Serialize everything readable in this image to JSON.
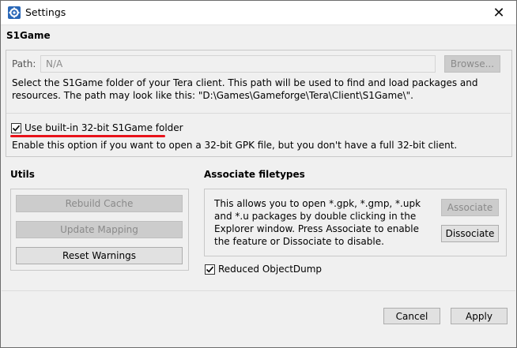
{
  "window": {
    "title": "Settings",
    "app_icon": "tera-gear-icon",
    "close_glyph": "✕"
  },
  "s1game": {
    "heading": "S1Game",
    "path_label": "Path:",
    "path_value": "N/A",
    "browse_label": "Browse...",
    "description": "Select the S1Game folder of your Tera client. This path will be used to find and load packages and resources. The path may look like this: \"D:\\Games\\Gameforge\\Tera\\Client\\S1Game\\\".",
    "builtin_label": "Use built-in 32-bit S1Game folder",
    "builtin_checked": true,
    "builtin_description": "Enable this option if you want to open a 32-bit GPK file, but you don't have a full 32-bit client."
  },
  "utils": {
    "heading": "Utils",
    "rebuild_cache_label": "Rebuild Cache",
    "update_mapping_label": "Update Mapping",
    "reset_warnings_label": "Reset Warnings"
  },
  "associate": {
    "heading": "Associate filetypes",
    "description": "This allows you to open *.gpk, *.gmp, *.upk and *.u packages by double clicking in the Explorer window. Press Associate to enable the feature or Dissociate to disable.",
    "associate_label": "Associate",
    "dissociate_label": "Dissociate"
  },
  "reduced_dump": {
    "label": "Reduced ObjectDump",
    "checked": true
  },
  "footer": {
    "cancel_label": "Cancel",
    "apply_label": "Apply"
  },
  "colors": {
    "highlight": "#e8121a",
    "accent_icon": "#1e6fc4"
  }
}
